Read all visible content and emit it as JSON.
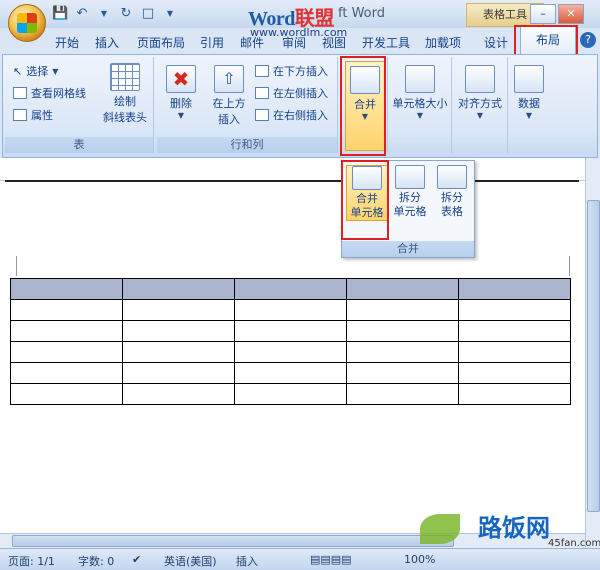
{
  "title": {
    "word_blue": "Word",
    "word_red": "联盟",
    "suffix": "ft Word",
    "context_tab": "表格工具",
    "watermark_url": "www.wordlm.com"
  },
  "tabs": [
    "开始",
    "插入",
    "页面布局",
    "引用",
    "邮件",
    "审阅",
    "视图",
    "开发工具",
    "加载项",
    "设计",
    "布局"
  ],
  "active_tab": "布局",
  "ribbon": {
    "group_table": {
      "label": "表",
      "select": "选择",
      "view_gridlines": "查看网格线",
      "properties": "属性",
      "draw_line1": "绘制",
      "draw_line2": "斜线表头"
    },
    "group_rows": {
      "label": "行和列",
      "delete": "删除",
      "insert_above_1": "在上方",
      "insert_above_2": "插入",
      "insert_below": "在下方插入",
      "insert_left": "在左侧插入",
      "insert_right": "在右侧插入"
    },
    "merge": "合并",
    "cell_size": "单元格大小",
    "alignment": "对齐方式",
    "data": "数据"
  },
  "dropdown": {
    "merge_cells_1": "合并",
    "merge_cells_2": "单元格",
    "split_cells_1": "拆分",
    "split_cells_2": "单元格",
    "split_table_1": "拆分",
    "split_table_2": "表格",
    "label": "合并"
  },
  "table": {
    "rows": 6,
    "cols": 5
  },
  "brand": {
    "name": "路饭网",
    "url": "45fan.com"
  },
  "status": {
    "page": "页面: 1/1",
    "words": "字数: 0",
    "language": "英语(美国)",
    "mode": "插入",
    "zoom": "100%"
  },
  "colors": {
    "highlight_box": "#e02020",
    "table_header": "#aab4cc"
  }
}
